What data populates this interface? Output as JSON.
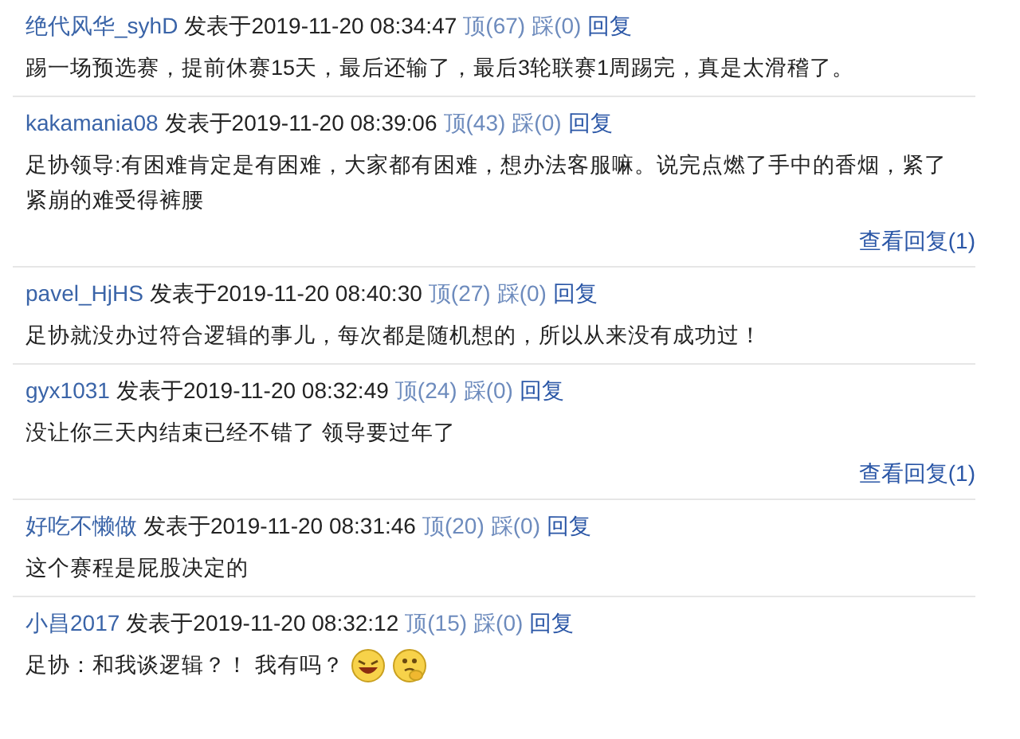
{
  "comments": [
    {
      "user": "绝代风华_syhD",
      "posted": "发表于2019-11-20 08:34:47",
      "up": "顶(67)",
      "down": "踩(0)",
      "reply": "回复",
      "body": "踢一场预选赛，提前休赛15天，最后还输了，最后3轮联赛1周踢完，真是太滑稽了。"
    },
    {
      "user": "kakamania08",
      "posted": "发表于2019-11-20 08:39:06",
      "up": "顶(43)",
      "down": "踩(0)",
      "reply": "回复",
      "body": "足协领导:有困难肯定是有困难，大家都有困难，想办法客服嘛。说完点燃了手中的香烟，紧了紧崩的难受得裤腰",
      "view_replies": "查看回复(1)"
    },
    {
      "user": "pavel_HjHS",
      "posted": "发表于2019-11-20 08:40:30",
      "up": "顶(27)",
      "down": "踩(0)",
      "reply": "回复",
      "body": "足协就没办过符合逻辑的事儿，每次都是随机想的，所以从来没有成功过！"
    },
    {
      "user": "gyx1031",
      "posted": "发表于2019-11-20 08:32:49",
      "up": "顶(24)",
      "down": "踩(0)",
      "reply": "回复",
      "body": "没让你三天内结束已经不错了 领导要过年了",
      "view_replies": "查看回复(1)"
    },
    {
      "user": "好吃不懒做",
      "posted": "发表于2019-11-20 08:31:46",
      "up": "顶(20)",
      "down": "踩(0)",
      "reply": "回复",
      "body": "这个赛程是屁股决定的"
    },
    {
      "user": "小昌2017",
      "posted": "发表于2019-11-20 08:32:12",
      "up": "顶(15)",
      "down": "踩(0)",
      "reply": "回复",
      "body": "足协：和我谈逻辑？！ 我有吗？",
      "emoticons": [
        {
          "kind": "laughing"
        },
        {
          "kind": "thinking"
        }
      ]
    }
  ]
}
